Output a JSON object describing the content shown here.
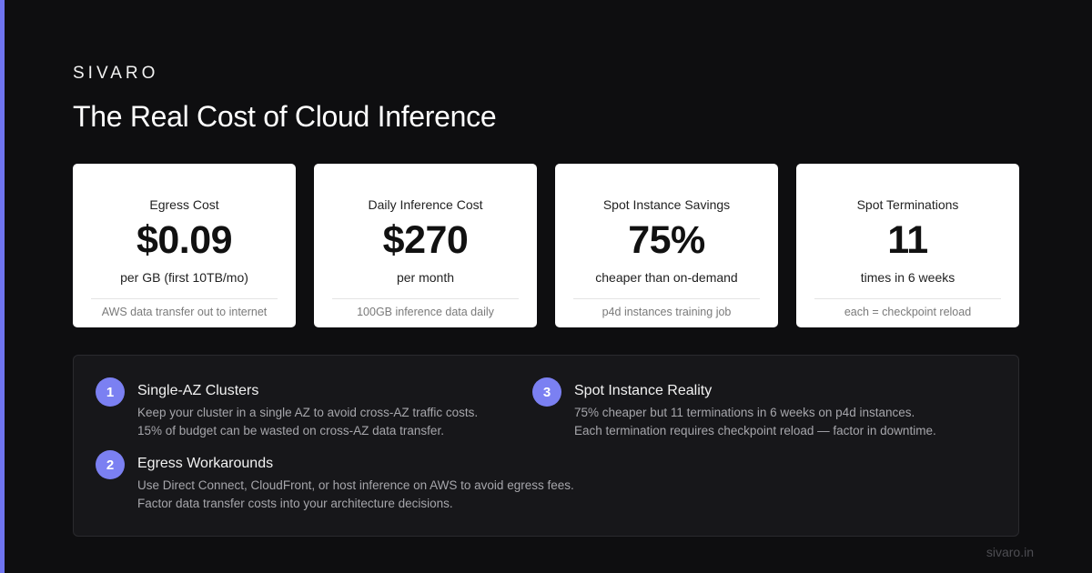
{
  "brand": "SIVARO",
  "title": "The Real Cost of Cloud Inference",
  "colors": {
    "accent": "#6f74f0",
    "badge": "#7b80f2",
    "background": "#0e0e10"
  },
  "cards": [
    {
      "label": "Egress Cost",
      "value": "$0.09",
      "sub": "per GB (first 10TB/mo)",
      "note": "AWS data transfer out to internet"
    },
    {
      "label": "Daily Inference Cost",
      "value": "$270",
      "sub": "per month",
      "note": "100GB inference data daily"
    },
    {
      "label": "Spot Instance Savings",
      "value": "75%",
      "sub": "cheaper than on-demand",
      "note": "p4d instances training job"
    },
    {
      "label": "Spot Terminations",
      "value": "11",
      "sub": "times in 6 weeks",
      "note": "each = checkpoint reload"
    }
  ],
  "tips": [
    {
      "num": "1",
      "title": "Single-AZ Clusters",
      "lines": [
        "Keep your cluster in a single AZ to avoid cross-AZ traffic costs.",
        "15% of budget can be wasted on cross-AZ data transfer."
      ]
    },
    {
      "num": "2",
      "title": "Egress Workarounds",
      "lines": [
        "Use Direct Connect, CloudFront, or host inference on AWS to avoid egress fees.",
        "Factor data transfer costs into your architecture decisions."
      ]
    },
    {
      "num": "3",
      "title": "Spot Instance Reality",
      "lines": [
        "75% cheaper but 11 terminations in 6 weeks on p4d instances.",
        "Each termination requires checkpoint reload — factor in downtime."
      ]
    }
  ],
  "footer": "sivaro.in"
}
